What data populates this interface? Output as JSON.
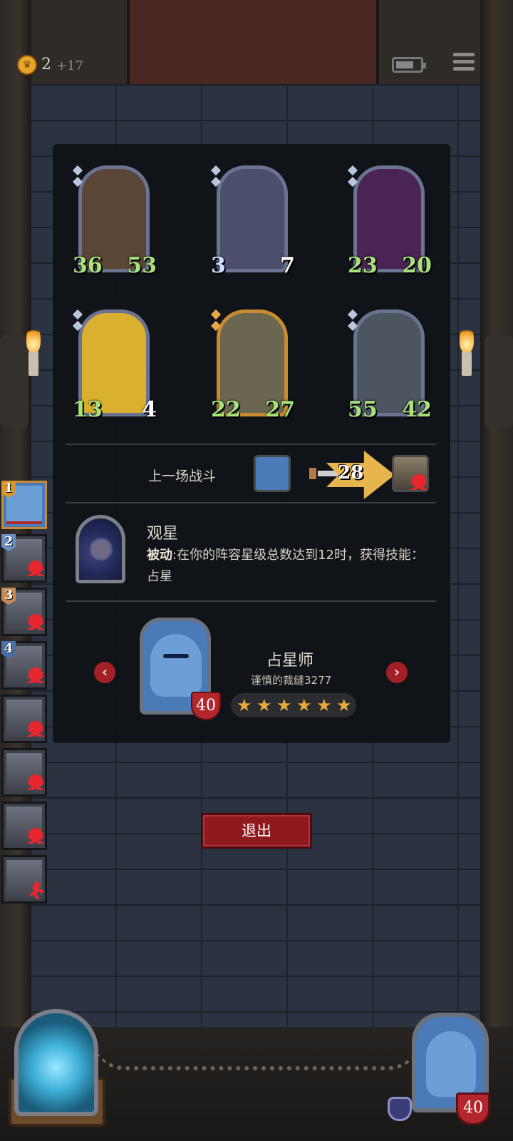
{
  "hud": {
    "gold": "2",
    "gold_bonus": "+17"
  },
  "board": {
    "units": [
      {
        "attack": "36",
        "health": "53",
        "atk_style": "green",
        "hp_style": "green",
        "frame": "silver",
        "bg": "#5a4636"
      },
      {
        "attack": "3",
        "health": "7",
        "atk_style": "blue",
        "hp_style": "red",
        "frame": "silver",
        "bg": "#4b4f6c"
      },
      {
        "attack": "23",
        "health": "20",
        "atk_style": "green",
        "hp_style": "green",
        "frame": "purple",
        "bg": "#4a2553"
      },
      {
        "attack": "13",
        "health": "4",
        "atk_style": "green",
        "hp_style": "red",
        "frame": "silver",
        "bg": "#d9b030"
      },
      {
        "attack": "22",
        "health": "27",
        "atk_style": "green",
        "hp_style": "green",
        "frame": "gold",
        "bg": "#6b6650"
      },
      {
        "attack": "55",
        "health": "42",
        "atk_style": "purple-badge",
        "hp_style": "green",
        "frame": "silver",
        "bg": "#4d5560"
      }
    ]
  },
  "last_battle": {
    "label": "上一场战斗",
    "damage": "28"
  },
  "ability": {
    "name": "观星",
    "tag": "被动",
    "text": ":在你的阵容星级总数达到12时，获得技能：占星"
  },
  "hero": {
    "name": "占星师",
    "player": "谨慎的裁缝3277",
    "health": "40",
    "stars": 6
  },
  "exit_label": "退出",
  "roster": [
    {
      "rank": "1",
      "rank_color": "#d9952c",
      "active": true,
      "status": "alive"
    },
    {
      "rank": "2",
      "rank_color": "#6a8fc7",
      "active": false,
      "status": "dead"
    },
    {
      "rank": "3",
      "rank_color": "#c58a55",
      "active": false,
      "status": "dead"
    },
    {
      "rank": "4",
      "rank_color": "#4b6fa8",
      "active": false,
      "status": "dead"
    },
    {
      "rank": "",
      "rank_color": "",
      "active": false,
      "status": "dead"
    },
    {
      "rank": "",
      "rank_color": "",
      "active": false,
      "status": "dead"
    },
    {
      "rank": "",
      "rank_color": "",
      "active": false,
      "status": "dead"
    },
    {
      "rank": "",
      "rank_color": "",
      "active": false,
      "status": "fled"
    }
  ],
  "player": {
    "health": "40"
  },
  "icons": {
    "coin": "crown-coin-icon",
    "battery": "battery-icon",
    "menu": "menu-icon",
    "sword": "sword-icon",
    "skull": "skull-crossbones-icon",
    "prev": "chevron-left-icon",
    "next": "chevron-right-icon",
    "star": "star-icon",
    "shield": "shield-icon"
  },
  "colors": {
    "accent_gold": "#e7a93a",
    "stat_green": "#a7e27b",
    "danger_red": "#b3262c"
  }
}
